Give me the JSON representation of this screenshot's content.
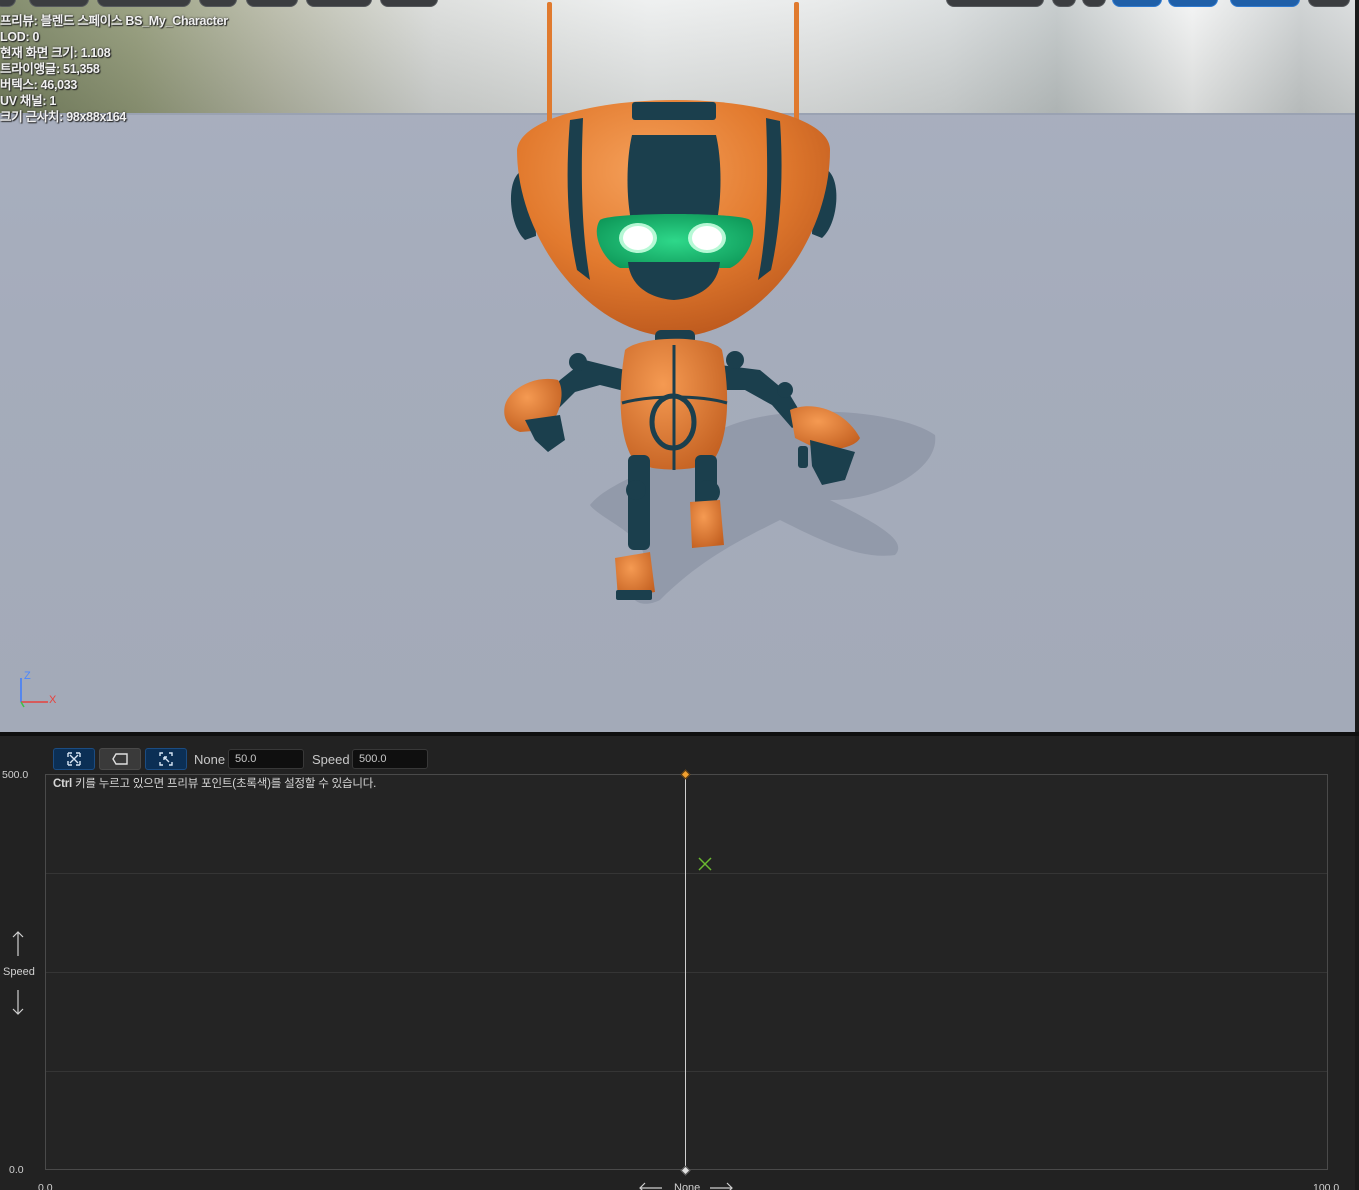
{
  "viewport": {
    "stats": [
      "프리뷰: 블렌드 스페이스 BS_My_Character",
      "LOD: 0",
      "현재 화면 크기: 1.108",
      "트라이앵글: 51,358",
      "버텍스: 46,033",
      "UV 채널: 1",
      "크기 근사치: 98x88x164"
    ],
    "axis_gizmo": {
      "z": "Z",
      "x": "X"
    },
    "colors": {
      "robot_body": "#e97b2e",
      "robot_dark": "#1b3f4d",
      "eyes": "#1ec870",
      "floor": "#a6adbc"
    }
  },
  "blendspace": {
    "toolbar": {
      "tool1_icon": "select-points-icon",
      "tool2_icon": "label-icon",
      "tool3_icon": "fit-view-icon",
      "param1_label": "None",
      "param1_value": "50.0",
      "param2_label": "Speed",
      "param2_value": "500.0"
    },
    "hint": {
      "key": "Ctrl",
      "text": " 키를 누르고 있으면 프리뷰 포인트(초록색)를 설정할 수 있습니다."
    },
    "y_axis": {
      "label": "Speed",
      "min": "0.0",
      "max": "500.0"
    },
    "x_axis": {
      "label": "None",
      "min": "0.0",
      "max": "100.0"
    },
    "sample_point": {
      "x": 50.0,
      "y": 500.0,
      "color": "#f0a030"
    },
    "preview_point": {
      "x": 51.4,
      "y": 385.0,
      "color": "#6ab830"
    }
  }
}
